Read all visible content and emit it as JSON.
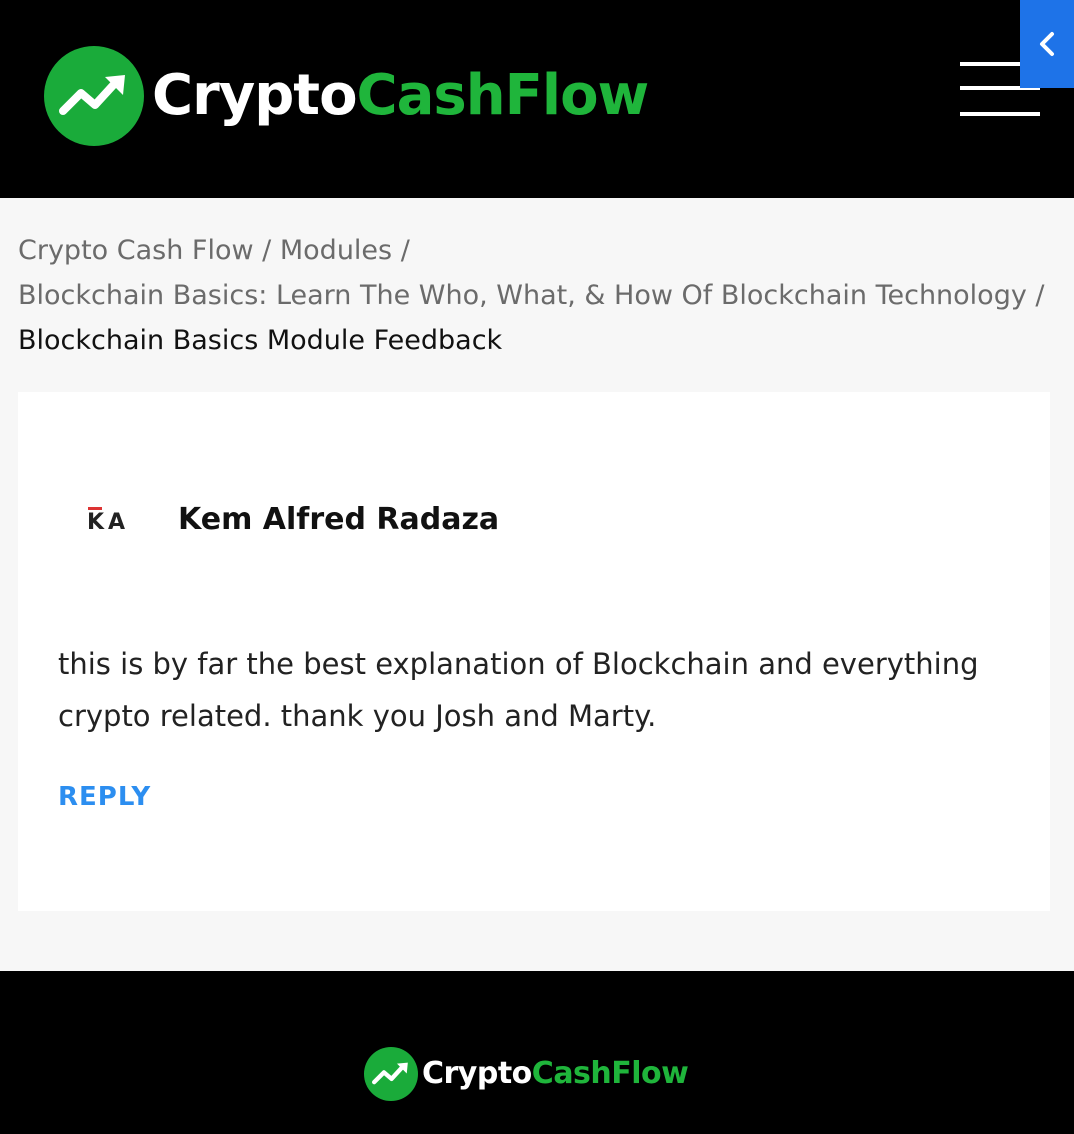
{
  "header": {
    "logo": {
      "part1": "Crypto",
      "part2": "CashFlow"
    },
    "menu_icon": "hamburger-menu-icon",
    "side_tab_icon": "chevron-left-icon"
  },
  "breadcrumb": {
    "items": [
      "Crypto Cash Flow",
      "Modules",
      "Blockchain Basics: Learn The Who, What, & How Of Blockchain Technology"
    ],
    "separator": "/",
    "current": "Blockchain Basics Module Feedback"
  },
  "comment": {
    "avatar_text": "KA",
    "author": "Kem Alfred Radaza",
    "body": "this is by far the best explanation of Blockchain and everything crypto related. thank you Josh and Marty.",
    "reply_label": "REPLY"
  },
  "footer": {
    "logo": {
      "part1": "Crypto",
      "part2": "CashFlow"
    }
  },
  "colors": {
    "brand_green": "#1fb53b",
    "accent_blue": "#1e73e8",
    "reply_blue": "#2c8ef0",
    "header_bg": "#000000"
  }
}
